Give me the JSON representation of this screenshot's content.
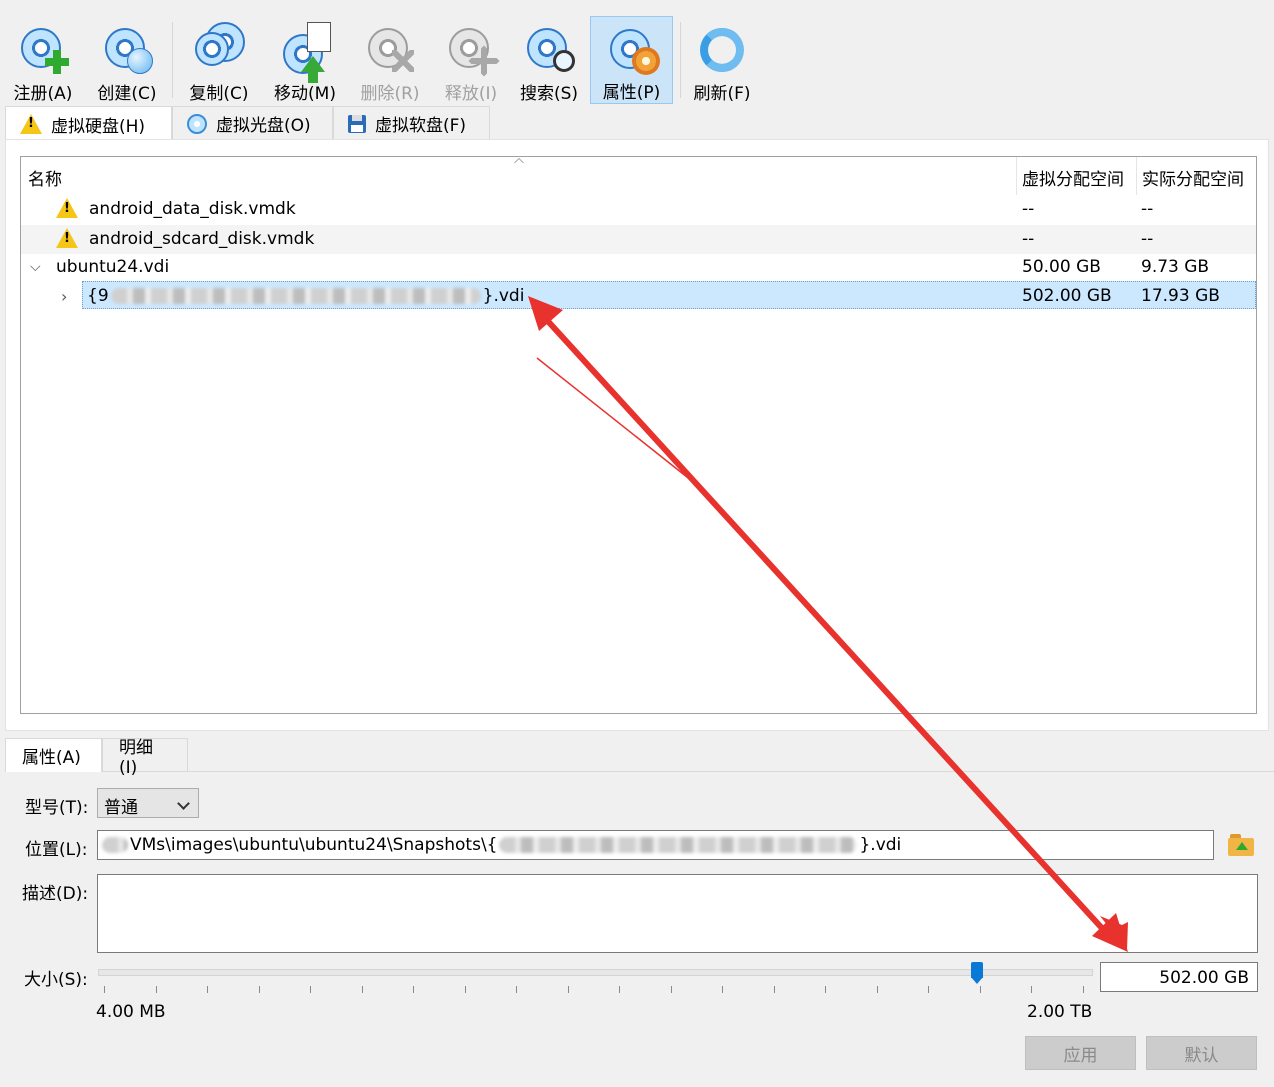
{
  "toolbar": {
    "buttons": [
      {
        "label": "注册(A)",
        "mnemonic": "A",
        "icon": "add-disk-icon",
        "state": "normal"
      },
      {
        "label": "创建(C)",
        "mnemonic": "C",
        "icon": "create-disk-icon",
        "state": "normal"
      },
      {
        "label": "复制(C)",
        "mnemonic": "C",
        "icon": "copy-disk-icon",
        "state": "normal"
      },
      {
        "label": "移动(M)",
        "mnemonic": "M",
        "icon": "move-disk-icon",
        "state": "normal"
      },
      {
        "label": "删除(R)",
        "mnemonic": "R",
        "icon": "remove-disk-icon",
        "state": "disabled"
      },
      {
        "label": "释放(I)",
        "mnemonic": "I",
        "icon": "release-disk-icon",
        "state": "disabled"
      },
      {
        "label": "搜索(S)",
        "mnemonic": "S",
        "icon": "search-disk-icon",
        "state": "normal"
      },
      {
        "label": "属性(P)",
        "mnemonic": "P",
        "icon": "properties-gear-icon",
        "state": "active"
      },
      {
        "label": "刷新(F)",
        "mnemonic": "F",
        "icon": "refresh-icon",
        "state": "normal"
      }
    ]
  },
  "media_tabs": [
    {
      "label": "虚拟硬盘(H)",
      "icon": "warning-icon",
      "active": true
    },
    {
      "label": "虚拟光盘(O)",
      "icon": "optical-disc-icon",
      "active": false
    },
    {
      "label": "虚拟软盘(F)",
      "icon": "floppy-disk-icon",
      "active": false
    }
  ],
  "table": {
    "columns": [
      "名称",
      "虚拟分配空间",
      "实际分配空间"
    ],
    "rows": [
      {
        "name": "android_data_disk.vmdk",
        "virtual": "--",
        "actual": "--",
        "icon": "warning-icon"
      },
      {
        "name": "android_sdcard_disk.vmdk",
        "virtual": "--",
        "actual": "--",
        "icon": "warning-icon"
      },
      {
        "name": "ubuntu24.vdi",
        "virtual": "50.00 GB",
        "actual": "9.73 GB",
        "icon": "chevron-down-icon"
      },
      {
        "name_prefix": "{9",
        "name_suffix": "}.vdi",
        "virtual": "502.00 GB",
        "actual": "17.93 GB",
        "icon": "chevron-right-icon",
        "selected": true
      }
    ]
  },
  "props": {
    "tabs": [
      "属性(A)",
      "明细(I)"
    ],
    "type_label": "型号(T):",
    "type_value": "普通",
    "location_label": "位置(L):",
    "location_mid": "VMs\\images\\ubuntu\\ubuntu24\\Snapshots\\{",
    "location_suffix": "}.vdi",
    "description_label": "描述(D):",
    "size_label": "大小(S):",
    "size_value": "502.00 GB",
    "size_fraction": 0.885,
    "slider_min": "4.00 MB",
    "slider_max": "2.00 TB",
    "apply_label": "应用",
    "reset_label": "默认"
  },
  "colors": {
    "accent": "#0a78d7",
    "selection": "#cce8ff",
    "annotation": "#e8322e"
  }
}
